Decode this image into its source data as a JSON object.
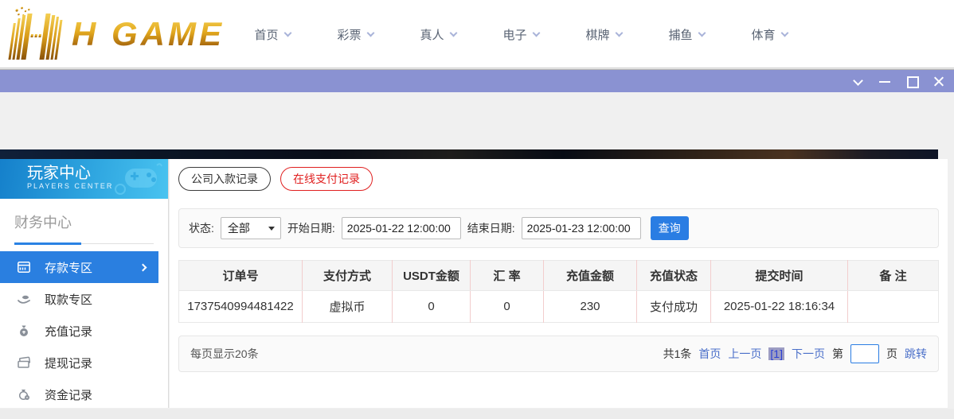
{
  "brand": {
    "logo_text": "H GAME"
  },
  "nav": {
    "items": [
      {
        "label": "首页"
      },
      {
        "label": "彩票"
      },
      {
        "label": "真人"
      },
      {
        "label": "电子"
      },
      {
        "label": "棋牌"
      },
      {
        "label": "捕鱼"
      },
      {
        "label": "体育"
      }
    ]
  },
  "sidebar": {
    "panel_title": "玩家中心",
    "panel_subtitle": "PLAYERS CENTER",
    "section_title": "财务中心",
    "items": [
      {
        "label": "存款专区",
        "active": true
      },
      {
        "label": "取款专区",
        "active": false
      },
      {
        "label": "充值记录",
        "active": false
      },
      {
        "label": "提现记录",
        "active": false
      },
      {
        "label": "资金记录",
        "active": false
      }
    ]
  },
  "main": {
    "tabs": [
      {
        "label": "公司入款记录",
        "active": false
      },
      {
        "label": "在线支付记录",
        "active": true
      }
    ],
    "filters": {
      "status_label": "状态:",
      "status_value": "全部",
      "start_label": "开始日期:",
      "start_value": "2025-01-22 12:00:00",
      "end_label": "结束日期:",
      "end_value": "2025-01-23 12:00:00",
      "search_button": "查询"
    },
    "table": {
      "headers": [
        "订单号",
        "支付方式",
        "USDT金额",
        "汇 率",
        "充值金额",
        "充值状态",
        "提交时间",
        "备 注"
      ],
      "rows": [
        [
          "1737540994481422",
          "虚拟币",
          "0",
          "0",
          "230",
          "支付成功",
          "2025-01-22 18:16:34",
          ""
        ]
      ]
    },
    "pagination": {
      "page_size_text": "每页显示20条",
      "total_text": "共1条",
      "first_label": "首页",
      "prev_label": "上一页",
      "current_page": "[1]",
      "next_label": "下一页",
      "jump_prefix": "第",
      "jump_suffix": "页",
      "jump_button": "跳转"
    }
  },
  "colors": {
    "brand_gold": "#d9a21d",
    "titlebar_purple": "#8a92d2",
    "active_blue": "#2a7fe0",
    "tab_active_red": "#e02020",
    "link_blue": "#4a6fc9",
    "sidebar_head_blue": "#2fa6e0"
  }
}
